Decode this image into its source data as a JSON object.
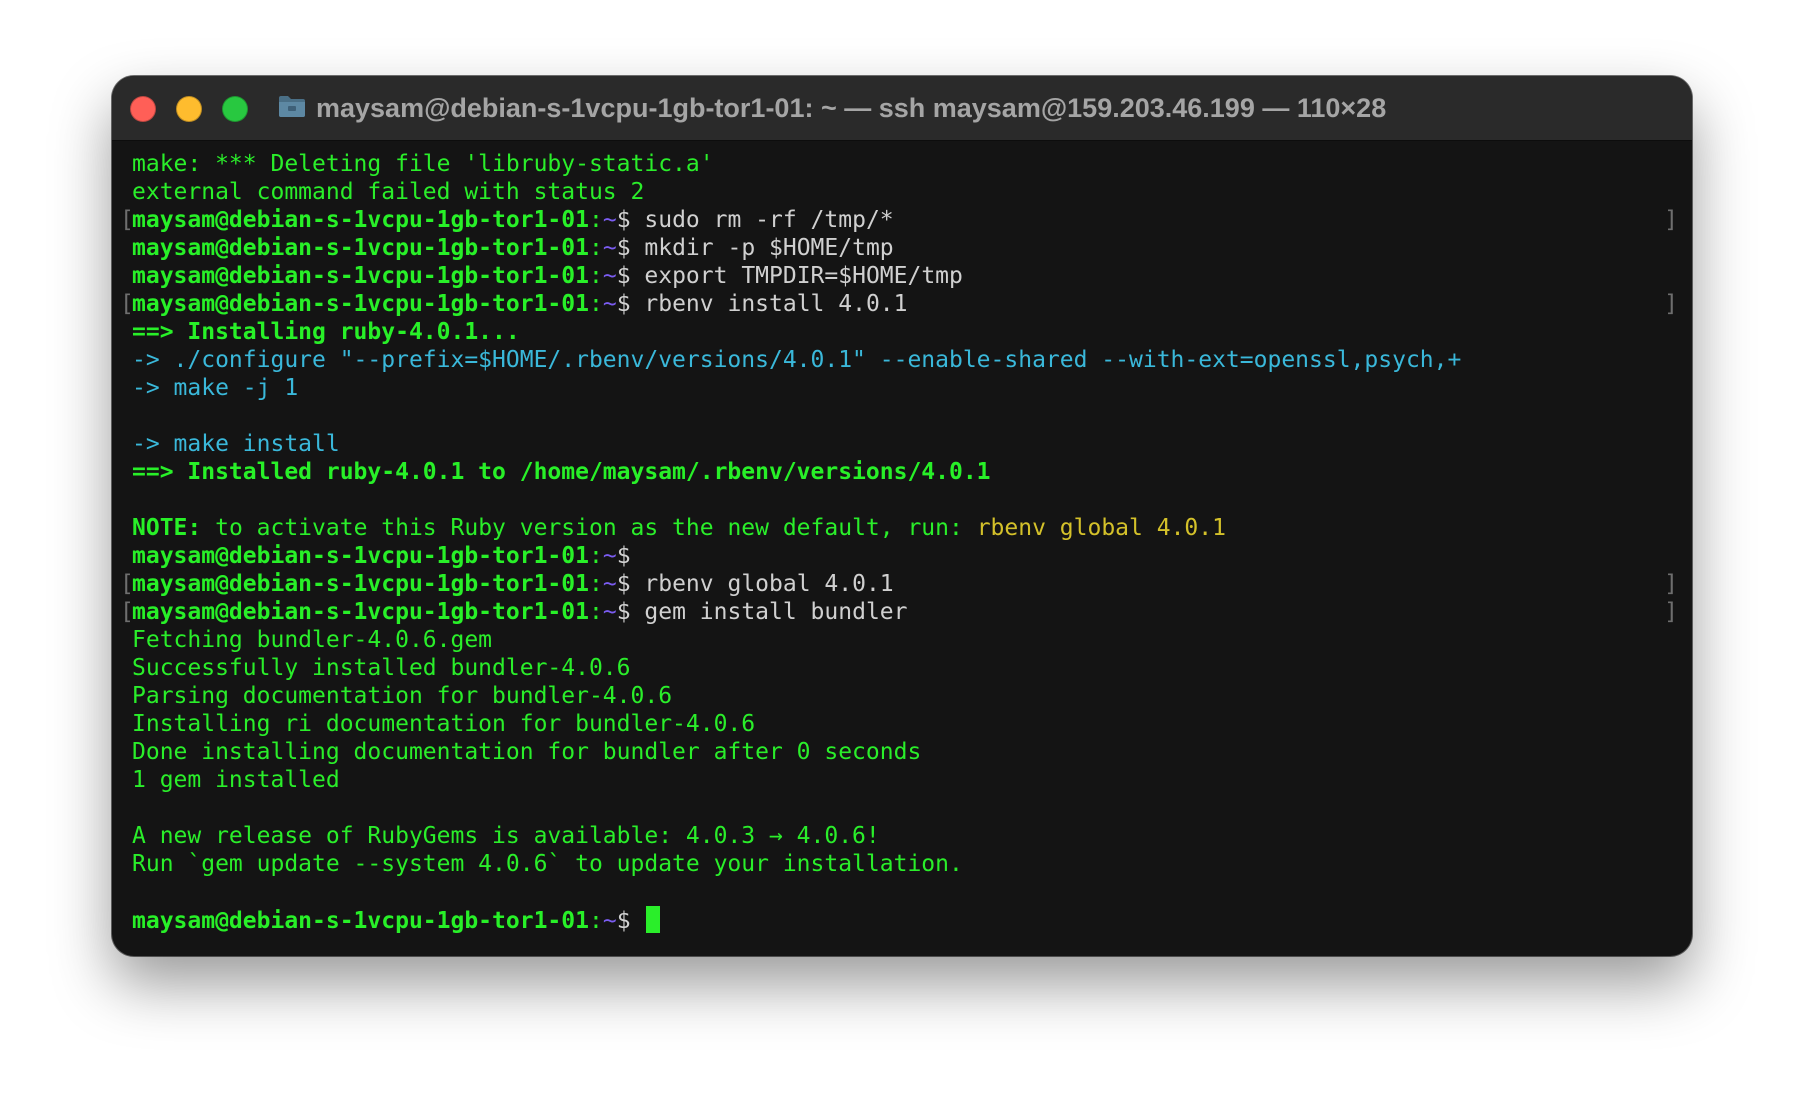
{
  "window": {
    "title": "maysam@debian-s-1vcpu-1gb-tor1-01: ~ — ssh maysam@159.203.46.199 — 110×28",
    "icons": {
      "close": "close-icon",
      "minimize": "minimize-icon",
      "zoom": "zoom-icon",
      "folder": "folder-icon"
    },
    "colors": {
      "background": "#141414",
      "green": "#2aee2a",
      "cyan": "#3ab8da",
      "yellow": "#d4c12a",
      "purple": "#7b5cf2"
    }
  },
  "prompt": {
    "user_host": "maysam@debian-s-1vcpu-1gb-tor1-01",
    "colon": ":",
    "path": "~",
    "symbol": "$"
  },
  "lines": {
    "l1": "make: *** Deleting file 'libruby-static.a'",
    "l2": "external command failed with status 2",
    "cmd1": " sudo rm -rf /tmp/*",
    "cmd2": " mkdir -p $HOME/tmp",
    "cmd3": " export TMPDIR=$HOME/tmp",
    "cmd4": " rbenv install 4.0.1",
    "installing": "==> Installing ruby-4.0.1...",
    "configure": "-> ./configure \"--prefix=$HOME/.rbenv/versions/4.0.1\" --enable-shared --with-ext=openssl,psych,+",
    "make": "-> make -j 1",
    "make_install": "-> make install",
    "installed": "==> Installed ruby-4.0.1 to /home/maysam/.rbenv/versions/4.0.1",
    "note_label": "NOTE:",
    "note_text": " to activate this Ruby version as the new default, run: ",
    "note_cmd": "rbenv global 4.0.1",
    "cmd6": " rbenv global 4.0.1",
    "cmd7": " gem install bundler",
    "fetching": "Fetching bundler-4.0.6.gem",
    "success": "Successfully installed bundler-4.0.6",
    "parsing": "Parsing documentation for bundler-4.0.6",
    "ri": "Installing ri documentation for bundler-4.0.6",
    "done": "Done installing documentation for bundler after 0 seconds",
    "gem_count": "1 gem installed",
    "new_release": "A new release of RubyGems is available: 4.0.3 → 4.0.6!",
    "run_update": "Run `gem update --system 4.0.6` to update your installation."
  },
  "brackets": {
    "left": "[",
    "right": "]"
  }
}
